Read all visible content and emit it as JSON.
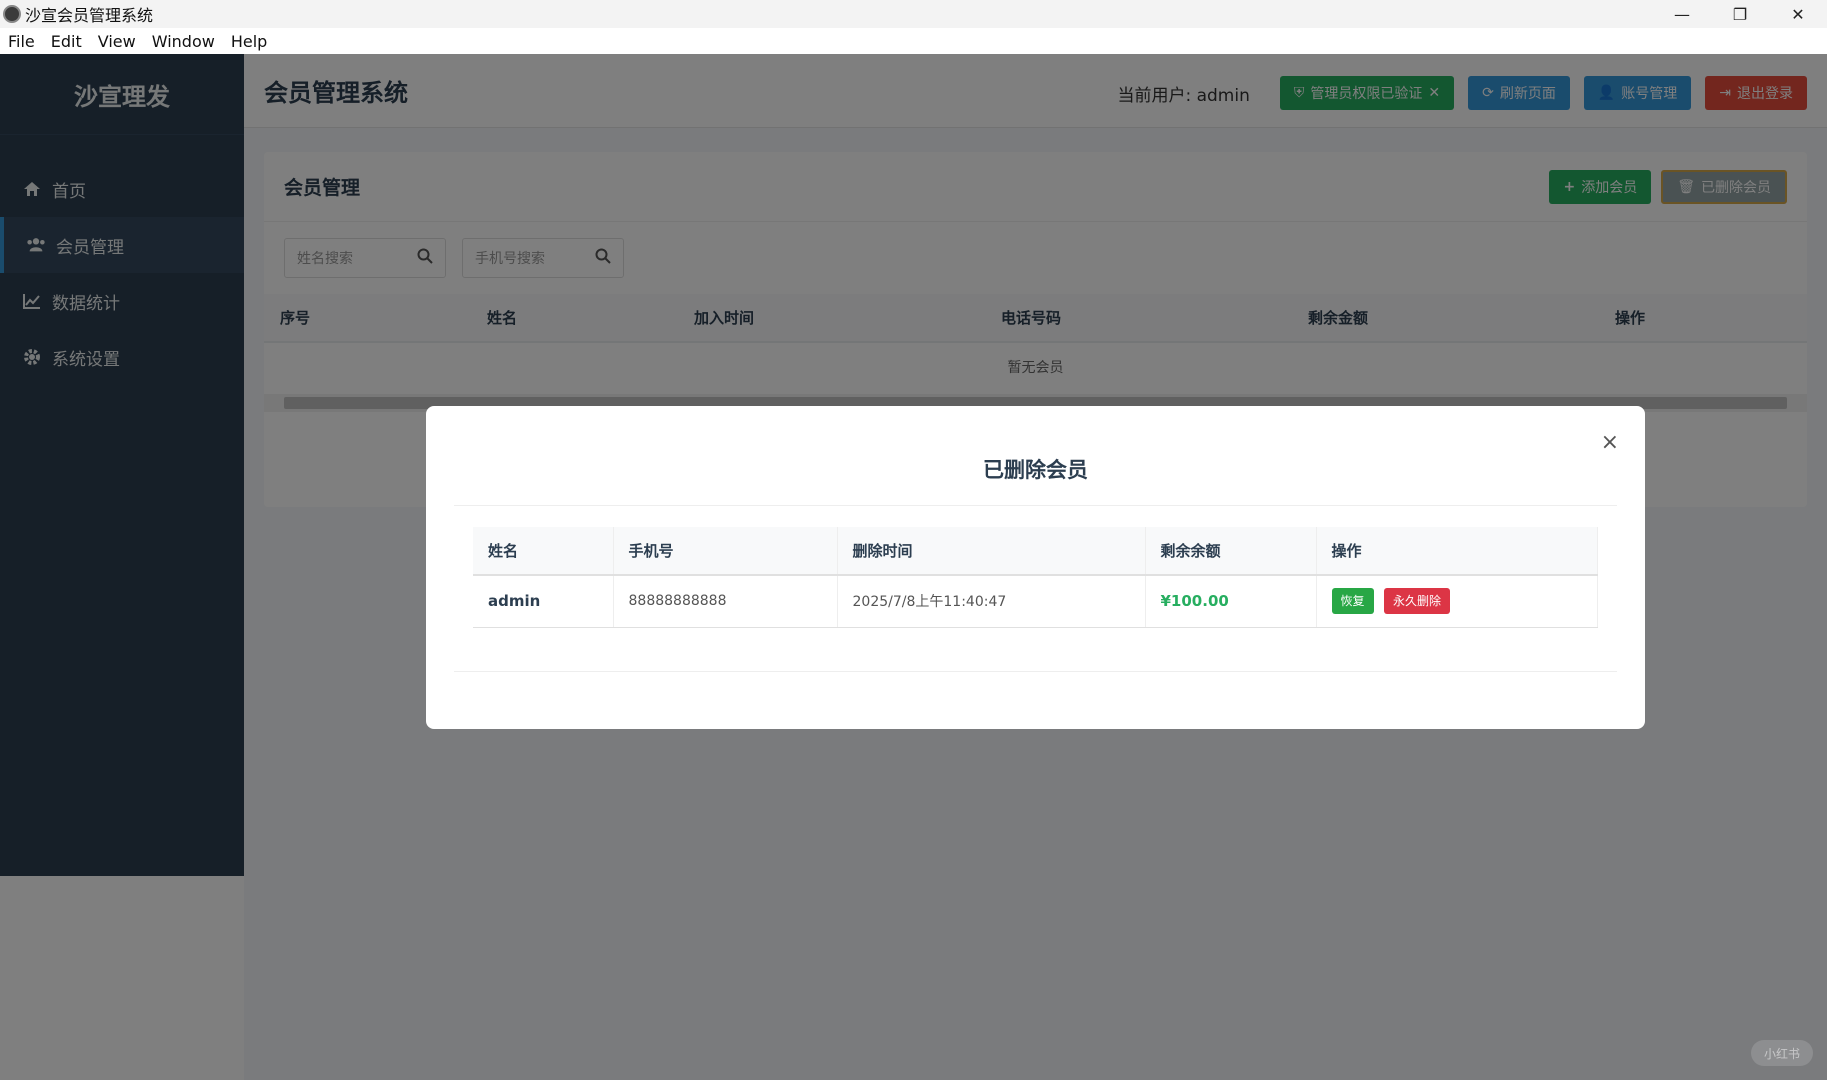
{
  "window": {
    "title": "沙宣会员管理系统",
    "minimize": "—",
    "restore": "❐",
    "close": "✕"
  },
  "menu": [
    "File",
    "Edit",
    "View",
    "Window",
    "Help"
  ],
  "sidebar": {
    "brand": "沙宣理发",
    "items": [
      {
        "label": "首页",
        "icon": "home-icon"
      },
      {
        "label": "会员管理",
        "icon": "users-icon"
      },
      {
        "label": "数据统计",
        "icon": "chart-icon"
      },
      {
        "label": "系统设置",
        "icon": "gear-icon"
      }
    ]
  },
  "header": {
    "title": "会员管理系统",
    "current_user": "当前用户: admin",
    "admin_verified": "管理员权限已验证",
    "refresh": "刷新页面",
    "account": "账号管理",
    "logout": "退出登录"
  },
  "members": {
    "title": "会员管理",
    "add": "添加会员",
    "deleted": "已删除会员",
    "name_placeholder": "姓名搜索",
    "phone_placeholder": "手机号搜索",
    "columns": [
      "序号",
      "姓名",
      "加入时间",
      "电话号码",
      "剩余金额",
      "操作"
    ],
    "empty": "暂无会员"
  },
  "modal": {
    "title": "已删除会员",
    "close": "×",
    "columns": [
      "姓名",
      "手机号",
      "删除时间",
      "剩余余额",
      "操作"
    ],
    "rows": [
      {
        "name": "admin",
        "phone": "88888888888",
        "deleted_at": "2025/7/8上午11:40:47",
        "balance": "¥100.00",
        "restore": "恢复",
        "purge": "永久删除"
      }
    ]
  },
  "watermark": "小红书"
}
